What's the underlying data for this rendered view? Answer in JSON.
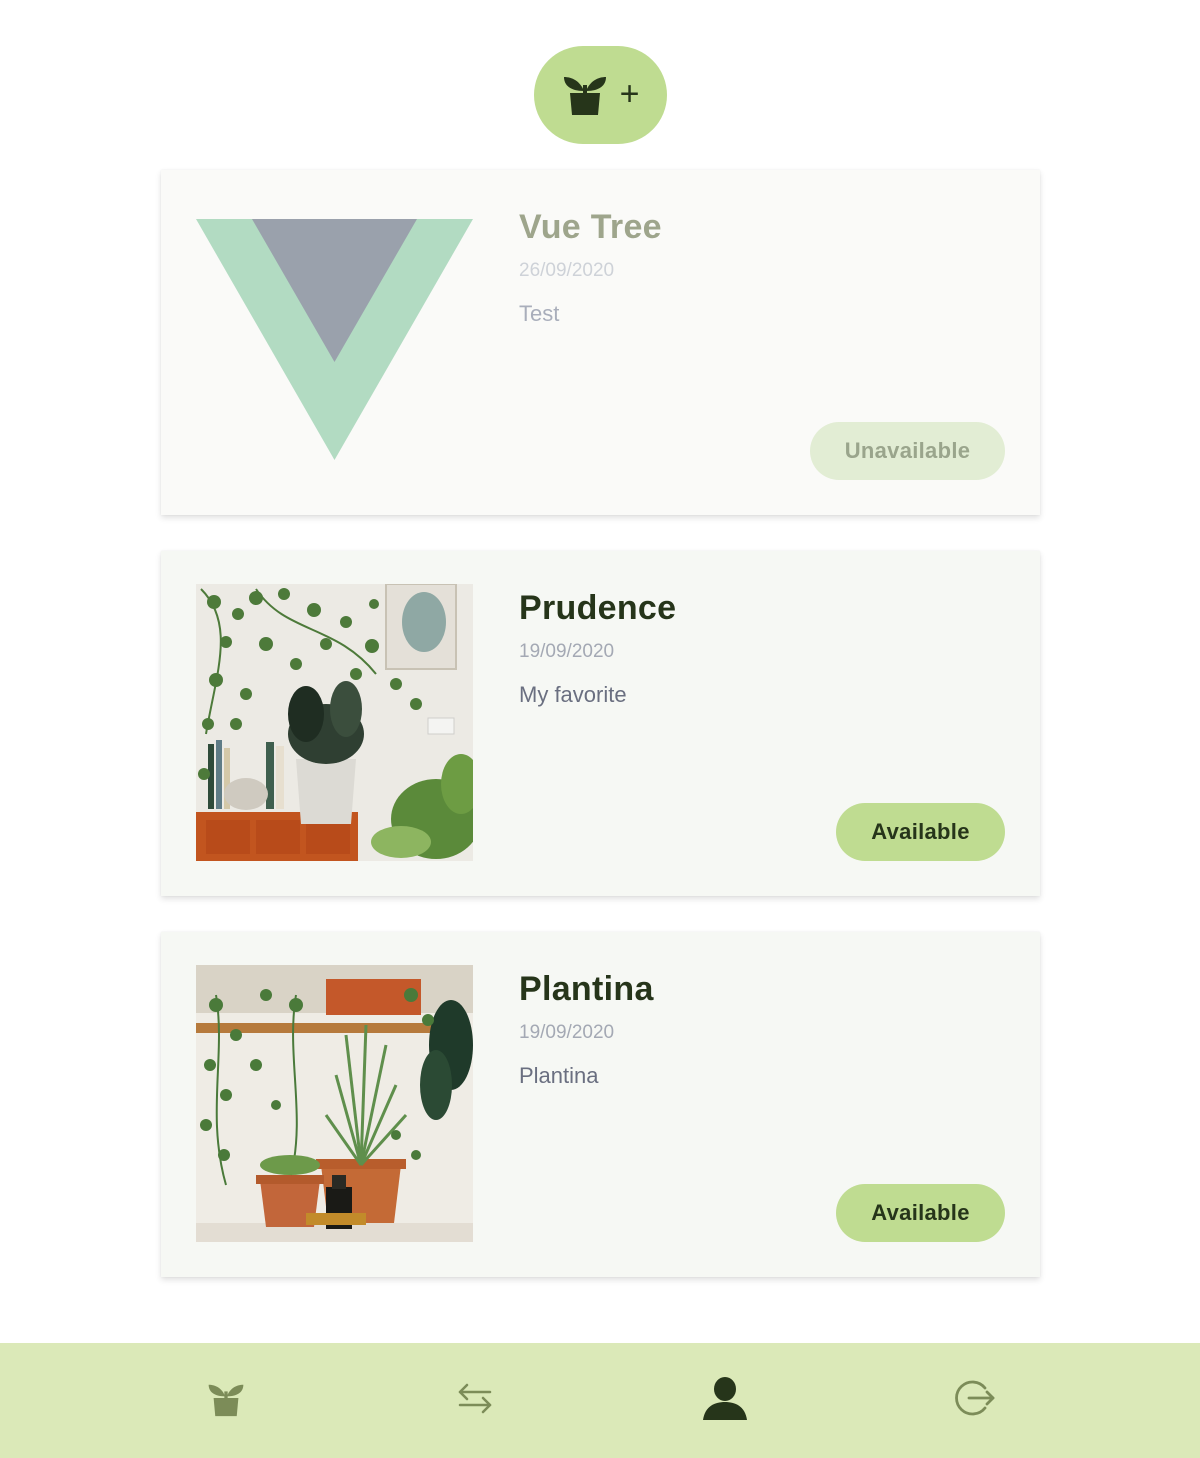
{
  "add_button": {
    "icon": "plant-add-icon",
    "plus": "+"
  },
  "plants": [
    {
      "name": "Vue Tree",
      "date": "26/09/2020",
      "description": "Test",
      "status": "Unavailable",
      "image": "vue-logo-image"
    },
    {
      "name": "Prudence",
      "date": "19/09/2020",
      "description": "My favorite",
      "status": "Available",
      "image": "plant-photo"
    },
    {
      "name": "Plantina",
      "date": "19/09/2020",
      "description": "Plantina",
      "status": "Available",
      "image": "plant-photo"
    }
  ],
  "bottom_nav": [
    {
      "icon": "plant-icon",
      "active": false
    },
    {
      "icon": "transfer-arrows-icon",
      "active": false
    },
    {
      "icon": "user-icon",
      "active": true
    },
    {
      "icon": "logout-icon",
      "active": false
    }
  ],
  "colors": {
    "accent": "#bfdc91",
    "nav_background": "#dbe9b8",
    "dark_text": "#26351a",
    "icon_inactive": "#7c8c58"
  }
}
